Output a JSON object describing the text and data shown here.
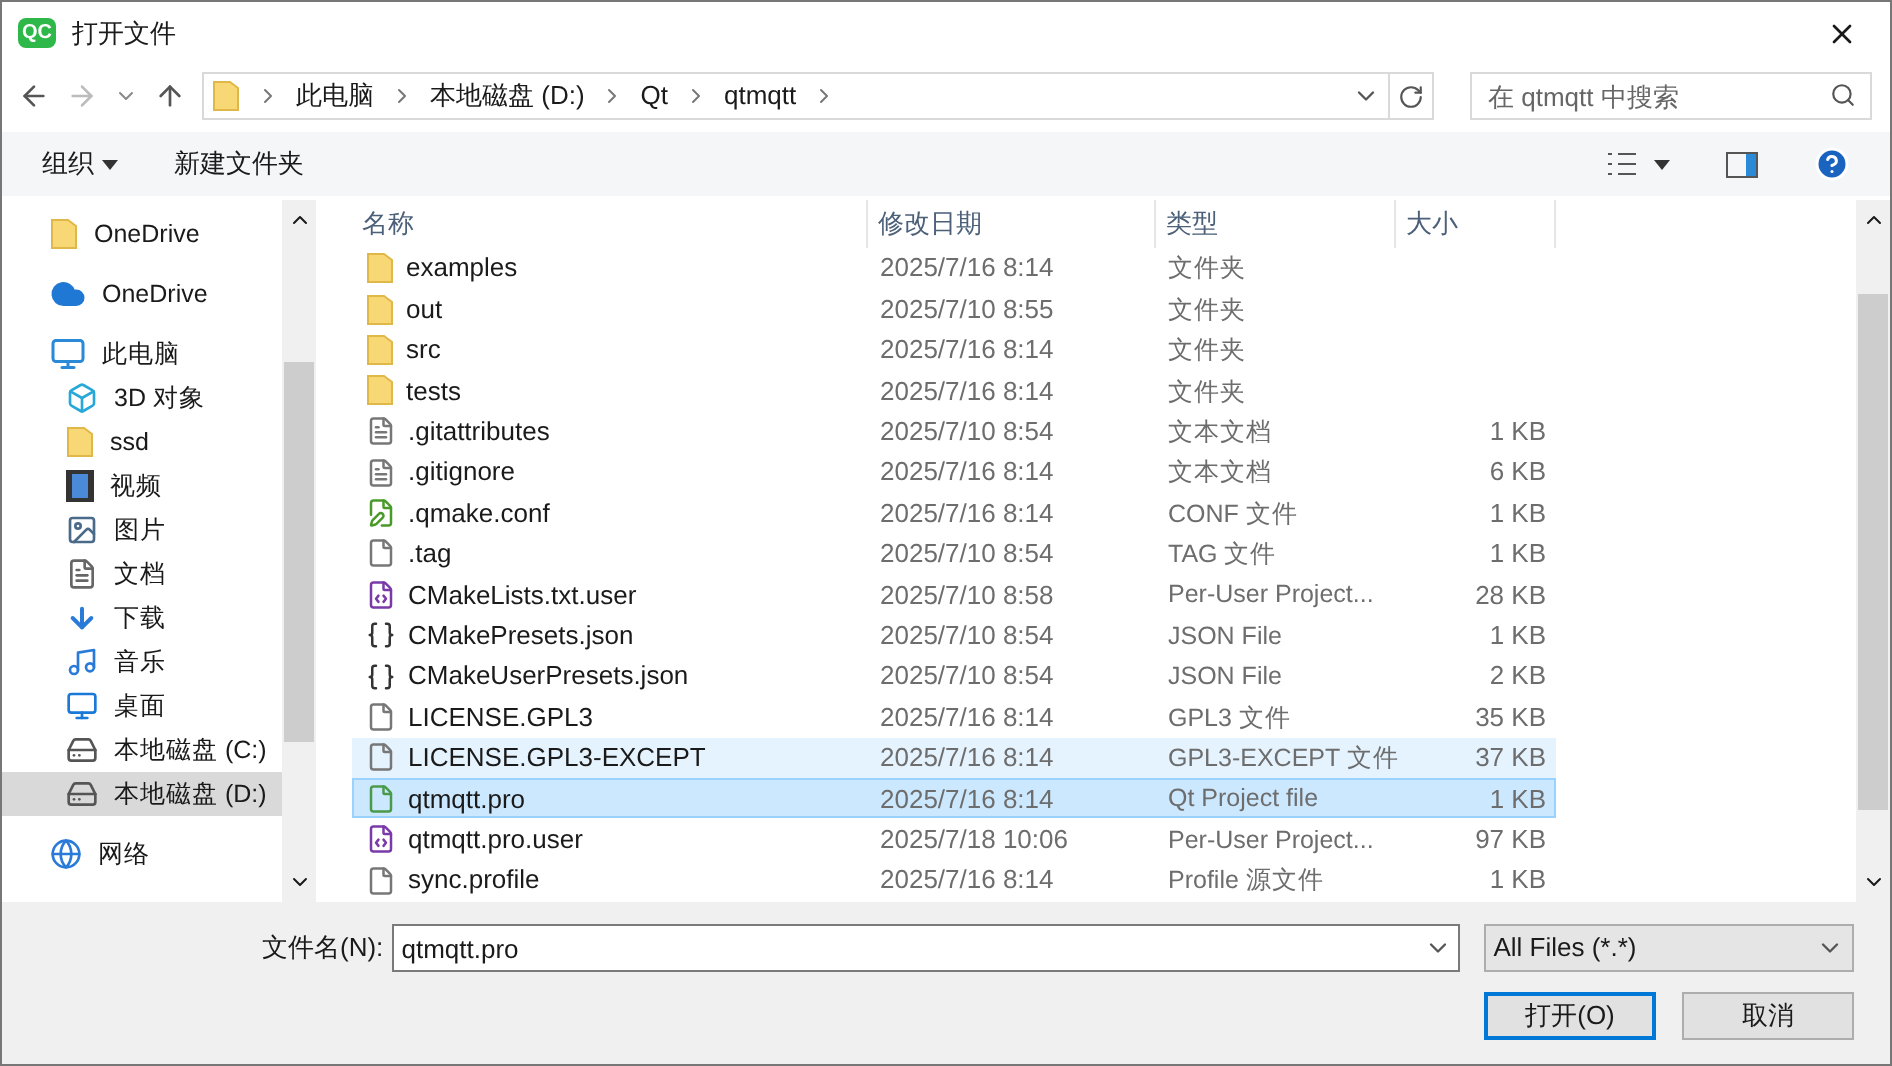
{
  "window": {
    "title": "打开文件",
    "app_icon": "QC"
  },
  "address": {
    "crumbs": [
      "此电脑",
      "本地磁盘 (D:)",
      "Qt",
      "qtmqtt"
    ]
  },
  "search": {
    "placeholder": "在 qtmqtt 中搜索"
  },
  "toolbar": {
    "organize": "组织",
    "new_folder": "新建文件夹"
  },
  "sidebar": {
    "items": [
      {
        "kind": "folder",
        "label": "OneDrive",
        "selected": false
      },
      {
        "kind": "cloud",
        "label": "OneDrive",
        "selected": false
      },
      {
        "kind": "pc",
        "label": "此电脑",
        "selected": false,
        "children": [
          {
            "kind": "cube",
            "label": "3D 对象",
            "selected": false
          },
          {
            "kind": "netfolder",
            "label": "ssd",
            "selected": false
          },
          {
            "kind": "video",
            "label": "视频",
            "selected": false
          },
          {
            "kind": "picture",
            "label": "图片",
            "selected": false
          },
          {
            "kind": "doc",
            "label": "文档",
            "selected": false
          },
          {
            "kind": "download",
            "label": "下载",
            "selected": false
          },
          {
            "kind": "music",
            "label": "音乐",
            "selected": false
          },
          {
            "kind": "desktop",
            "label": "桌面",
            "selected": false
          },
          {
            "kind": "drive",
            "label": "本地磁盘 (C:)",
            "selected": false
          },
          {
            "kind": "drive",
            "label": "本地磁盘 (D:)",
            "selected": true
          }
        ]
      },
      {
        "kind": "network",
        "label": "网络",
        "selected": false
      }
    ]
  },
  "table": {
    "columns": [
      "名称",
      "修改日期",
      "类型",
      "大小"
    ],
    "rows": [
      {
        "kind": "folder",
        "name": "examples",
        "date": "2025/7/16 8:14",
        "type": "文件夹",
        "size": "",
        "selected": false,
        "hovered": false
      },
      {
        "kind": "folder",
        "name": "out",
        "date": "2025/7/10 8:55",
        "type": "文件夹",
        "size": "",
        "selected": false,
        "hovered": false
      },
      {
        "kind": "folder",
        "name": "src",
        "date": "2025/7/16 8:14",
        "type": "文件夹",
        "size": "",
        "selected": false,
        "hovered": false
      },
      {
        "kind": "folder",
        "name": "tests",
        "date": "2025/7/16 8:14",
        "type": "文件夹",
        "size": "",
        "selected": false,
        "hovered": false
      },
      {
        "kind": "text",
        "name": ".gitattributes",
        "date": "2025/7/10 8:54",
        "type": "文本文档",
        "size": "1 KB",
        "selected": false,
        "hovered": false
      },
      {
        "kind": "text",
        "name": ".gitignore",
        "date": "2025/7/16 8:14",
        "type": "文本文档",
        "size": "6 KB",
        "selected": false,
        "hovered": false
      },
      {
        "kind": "conf",
        "name": ".qmake.conf",
        "date": "2025/7/16 8:14",
        "type": "CONF 文件",
        "size": "1 KB",
        "selected": false,
        "hovered": false
      },
      {
        "kind": "blank",
        "name": ".tag",
        "date": "2025/7/10 8:54",
        "type": "TAG 文件",
        "size": "1 KB",
        "selected": false,
        "hovered": false
      },
      {
        "kind": "vsuser",
        "name": "CMakeLists.txt.user",
        "date": "2025/7/10 8:58",
        "type": "Per-User Project...",
        "size": "28 KB",
        "selected": false,
        "hovered": false
      },
      {
        "kind": "json",
        "name": "CMakePresets.json",
        "date": "2025/7/10 8:54",
        "type": "JSON File",
        "size": "1 KB",
        "selected": false,
        "hovered": false
      },
      {
        "kind": "json",
        "name": "CMakeUserPresets.json",
        "date": "2025/7/10 8:54",
        "type": "JSON File",
        "size": "2 KB",
        "selected": false,
        "hovered": false
      },
      {
        "kind": "blank",
        "name": "LICENSE.GPL3",
        "date": "2025/7/16 8:14",
        "type": "GPL3 文件",
        "size": "35 KB",
        "selected": false,
        "hovered": false
      },
      {
        "kind": "blank",
        "name": "LICENSE.GPL3-EXCEPT",
        "date": "2025/7/16 8:14",
        "type": "GPL3-EXCEPT 文件",
        "size": "37 KB",
        "selected": false,
        "hovered": true
      },
      {
        "kind": "pro",
        "name": "qtmqtt.pro",
        "date": "2025/7/16 8:14",
        "type": "Qt Project file",
        "size": "1 KB",
        "selected": true,
        "hovered": false
      },
      {
        "kind": "vsuser",
        "name": "qtmqtt.pro.user",
        "date": "2025/7/18 10:06",
        "type": "Per-User Project...",
        "size": "97 KB",
        "selected": false,
        "hovered": false
      },
      {
        "kind": "blank",
        "name": "sync.profile",
        "date": "2025/7/16 8:14",
        "type": "Profile 源文件",
        "size": "1 KB",
        "selected": false,
        "hovered": false
      }
    ]
  },
  "footer": {
    "filename_label": "文件名(N):",
    "filename": "qtmqtt.pro",
    "filter": "All Files (*.*)",
    "open": "打开(O)",
    "cancel": "取消"
  }
}
